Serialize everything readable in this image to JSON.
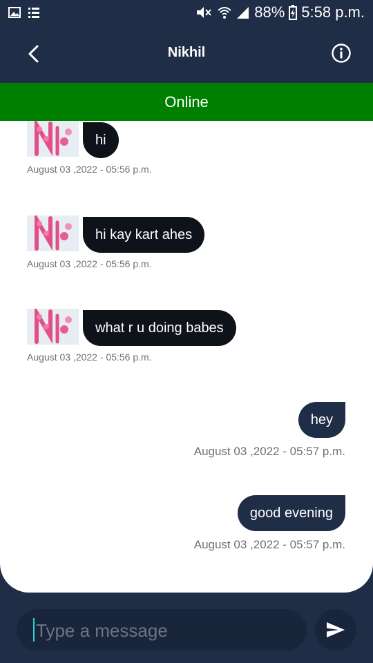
{
  "status_bar": {
    "battery": "88%",
    "time": "5:58 p.m.",
    "icons": [
      "image-icon",
      "list-icon",
      "mute-icon",
      "wifi-icon",
      "signal-icon",
      "battery-icon"
    ]
  },
  "header": {
    "title": "Nikhil",
    "status": "Online",
    "colors": {
      "header_bg": "#1f2d46",
      "online_bg": "#008000"
    }
  },
  "messages": [
    {
      "direction": "in",
      "text": "hi",
      "time": "August 03 ,2022 - 05:56 p.m."
    },
    {
      "direction": "in",
      "text": "hi kay kart ahes",
      "time": "August 03 ,2022 - 05:56 p.m."
    },
    {
      "direction": "in",
      "text": "what r u doing babes",
      "time": "August 03 ,2022 - 05:56 p.m."
    },
    {
      "direction": "out",
      "text": "hey",
      "time": "August 03 ,2022 - 05:57 p.m."
    },
    {
      "direction": "out",
      "text": "good evening",
      "time": "August 03 ,2022 - 05:57 p.m."
    }
  ],
  "composer": {
    "placeholder": "Type a message",
    "value": ""
  }
}
